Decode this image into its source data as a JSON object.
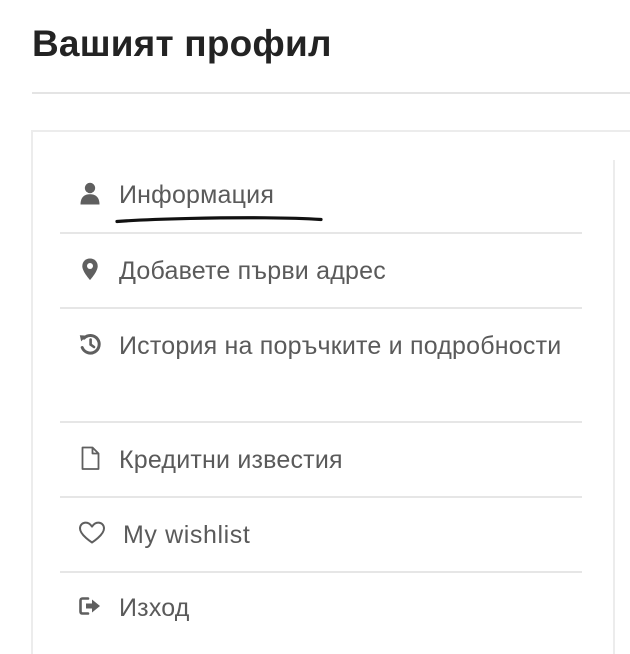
{
  "page": {
    "title": "Вашият профил"
  },
  "menu": {
    "items": [
      {
        "label": "Информация",
        "icon": "user-icon"
      },
      {
        "label": "Добавете първи адрес",
        "icon": "map-marker-icon"
      },
      {
        "label": "История на поръчките и подробности",
        "icon": "history-icon"
      },
      {
        "label": "Кредитни известия",
        "icon": "document-icon"
      },
      {
        "label": "My wishlist",
        "icon": "heart-icon"
      },
      {
        "label": "Изход",
        "icon": "sign-out-icon"
      }
    ]
  },
  "colors": {
    "title": "#232323",
    "text": "#5a5a5a",
    "divider": "#e6e6e6",
    "underline": "#111111"
  }
}
